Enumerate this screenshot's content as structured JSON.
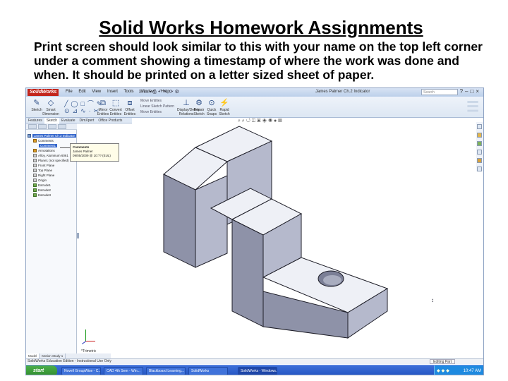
{
  "slide": {
    "title": "Solid Works Homework Assignments",
    "body": "Print screen should look similar to this with your name on the top left corner under a comment showing a timestamp of where the work was done and when.  It should be printed on a letter sized sheet of paper."
  },
  "window": {
    "logo": "SolidWorks",
    "menus": [
      "File",
      "Edit",
      "View",
      "Insert",
      "Tools",
      "Window",
      "Help"
    ],
    "doc_title": "James Palmer Ch.2 Indicator",
    "search_placeholder": "Search"
  },
  "ribbon": {
    "tools": [
      {
        "label": "Sketch",
        "glyph": "✎"
      },
      {
        "label": "Smart Dimension",
        "glyph": "◇"
      },
      {
        "label": "Mirror Entities",
        "glyph": "⧉"
      },
      {
        "label": "Convert Entities",
        "glyph": "⬚"
      },
      {
        "label": "Offset Entities",
        "glyph": "⧈"
      },
      {
        "label": "Display/Delete Relations",
        "glyph": "⊥"
      },
      {
        "label": "Repair Sketch",
        "glyph": "⚙"
      },
      {
        "label": "Quick Snaps",
        "glyph": "⊙"
      },
      {
        "label": "Rapid Sketch",
        "glyph": "⚡"
      }
    ],
    "small_labels": [
      "Move Entities",
      "Linear Sketch Pattern",
      "Move Entities"
    ]
  },
  "command_tabs": [
    "Features",
    "Sketch",
    "Evaluate",
    "DimXpert",
    "Office Products"
  ],
  "tree": {
    "items": [
      {
        "label": "James Palmer Ch.2 Indicator",
        "icon": "part-icon",
        "level": 0,
        "selected": true
      },
      {
        "label": "Comments",
        "icon": "comment-folder-icon",
        "level": 1
      },
      {
        "label": "Comment1",
        "icon": "comment-icon",
        "level": 2,
        "selected": true
      },
      {
        "label": "Annotations",
        "icon": "annotations-icon",
        "level": 1
      },
      {
        "label": "Alloy, Aluminum 6061",
        "icon": "material-icon",
        "level": 1
      },
      {
        "label": "Plane1 (not specified)",
        "icon": "plane-icon",
        "level": 1
      },
      {
        "label": "Front Plane",
        "icon": "plane-icon",
        "level": 1
      },
      {
        "label": "Top Plane",
        "icon": "plane-icon",
        "level": 1
      },
      {
        "label": "Right Plane",
        "icon": "plane-icon",
        "level": 1
      },
      {
        "label": "Origin",
        "icon": "origin-icon",
        "level": 1
      },
      {
        "label": "Extrude1",
        "icon": "extrude-icon",
        "level": 1
      },
      {
        "label": "Extrude2",
        "icon": "extrude-icon",
        "level": 1
      },
      {
        "label": "Extrude3",
        "icon": "extrude-icon",
        "level": 1
      }
    ]
  },
  "tooltip": {
    "heading": "Comments",
    "line1": "James Palmer",
    "line2": "09/05/2009 @ 10:?? (EUL)"
  },
  "view": {
    "label": "*Trimetric",
    "triad": {
      "x": "X",
      "y": "Y"
    }
  },
  "model_tabs": [
    "Model",
    "Motion Study 1"
  ],
  "status": {
    "left": "SolidWorks Education Edition - Instructional Use Only",
    "right": "Editing Part"
  },
  "taskbar": {
    "start": "start",
    "buttons": [
      "Novell GroupWise - C...",
      "CAD 4th Sem - Win...",
      "Blackboard Learning...",
      "SolidWorks",
      "SolidWorks - Windows..."
    ],
    "clock": "10:47 AM"
  },
  "colors": {
    "face_top": "#eef0f6",
    "face_left": "#8e92a8",
    "face_right": "#b5b9cc",
    "edge": "#1e1e28"
  }
}
